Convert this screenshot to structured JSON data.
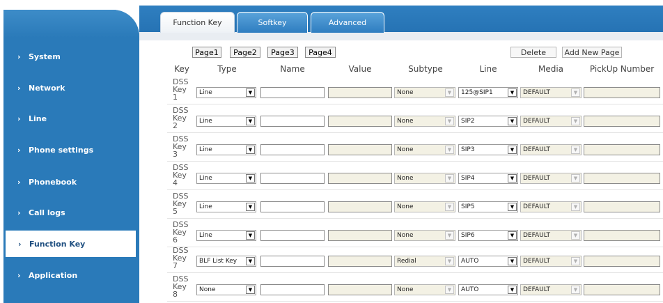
{
  "nav": {
    "items": [
      {
        "label": "System"
      },
      {
        "label": "Network"
      },
      {
        "label": "Line"
      },
      {
        "label": "Phone settings"
      },
      {
        "label": "Phonebook"
      },
      {
        "label": "Call logs"
      },
      {
        "label": "Function Key",
        "active": true
      },
      {
        "label": "Application"
      }
    ]
  },
  "tabs": [
    {
      "label": "Function Key",
      "active": true
    },
    {
      "label": "Softkey",
      "active": false
    },
    {
      "label": "Advanced",
      "active": false
    }
  ],
  "page_buttons": [
    "Page1",
    "Page2",
    "Page3",
    "Page4"
  ],
  "actions": {
    "delete": "Delete",
    "add_new_page": "Add New Page"
  },
  "columns": [
    "Key",
    "Type",
    "Name",
    "Value",
    "Subtype",
    "Line",
    "Media",
    "PickUp Number"
  ],
  "rows": [
    {
      "key": [
        "DSS",
        "Key",
        "1"
      ],
      "type": "Line",
      "name": "",
      "value": "",
      "subtype": "None",
      "line": "125@SIP1",
      "media": "DEFAULT",
      "pickup": ""
    },
    {
      "key": [
        "DSS",
        "Key",
        "2"
      ],
      "type": "Line",
      "name": "",
      "value": "",
      "subtype": "None",
      "line": "SIP2",
      "media": "DEFAULT",
      "pickup": ""
    },
    {
      "key": [
        "DSS",
        "Key",
        "3"
      ],
      "type": "Line",
      "name": "",
      "value": "",
      "subtype": "None",
      "line": "SIP3",
      "media": "DEFAULT",
      "pickup": ""
    },
    {
      "key": [
        "DSS",
        "Key",
        "4"
      ],
      "type": "Line",
      "name": "",
      "value": "",
      "subtype": "None",
      "line": "SIP4",
      "media": "DEFAULT",
      "pickup": ""
    },
    {
      "key": [
        "DSS",
        "Key",
        "5"
      ],
      "type": "Line",
      "name": "",
      "value": "",
      "subtype": "None",
      "line": "SIP5",
      "media": "DEFAULT",
      "pickup": ""
    },
    {
      "key": [
        "DSS",
        "Key",
        "6"
      ],
      "type": "Line",
      "name": "",
      "value": "",
      "subtype": "None",
      "line": "SIP6",
      "media": "DEFAULT",
      "pickup": ""
    },
    {
      "key": [
        "DSS",
        "Key",
        "7"
      ],
      "type": "BLF List Key",
      "name": "",
      "value": "",
      "subtype": "Redial",
      "line": "AUTO",
      "media": "DEFAULT",
      "pickup": ""
    },
    {
      "key": [
        "DSS",
        "Key",
        "8"
      ],
      "type": "None",
      "name": "",
      "value": "",
      "subtype": "None",
      "line": "AUTO",
      "media": "DEFAULT",
      "pickup": ""
    }
  ]
}
